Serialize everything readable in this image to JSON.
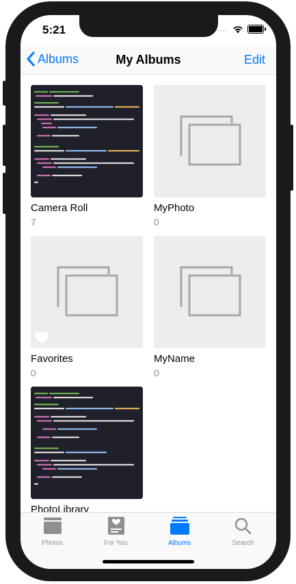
{
  "status": {
    "time": "5:21",
    "signal_dots": "....."
  },
  "nav": {
    "back_label": "Albums",
    "title": "My Albums",
    "edit_label": "Edit"
  },
  "albums": [
    {
      "title": "Camera Roll",
      "count": "7"
    },
    {
      "title": "MyPhoto",
      "count": "0"
    },
    {
      "title": "Favorites",
      "count": "0"
    },
    {
      "title": "MyName",
      "count": "0"
    },
    {
      "title": "PhotoLibrary",
      "count": ""
    }
  ],
  "tabs": [
    {
      "label": "Photos"
    },
    {
      "label": "For You"
    },
    {
      "label": "Albums"
    },
    {
      "label": "Search"
    }
  ],
  "colors": {
    "accent": "#007aff",
    "inactive": "#8e8e93"
  }
}
